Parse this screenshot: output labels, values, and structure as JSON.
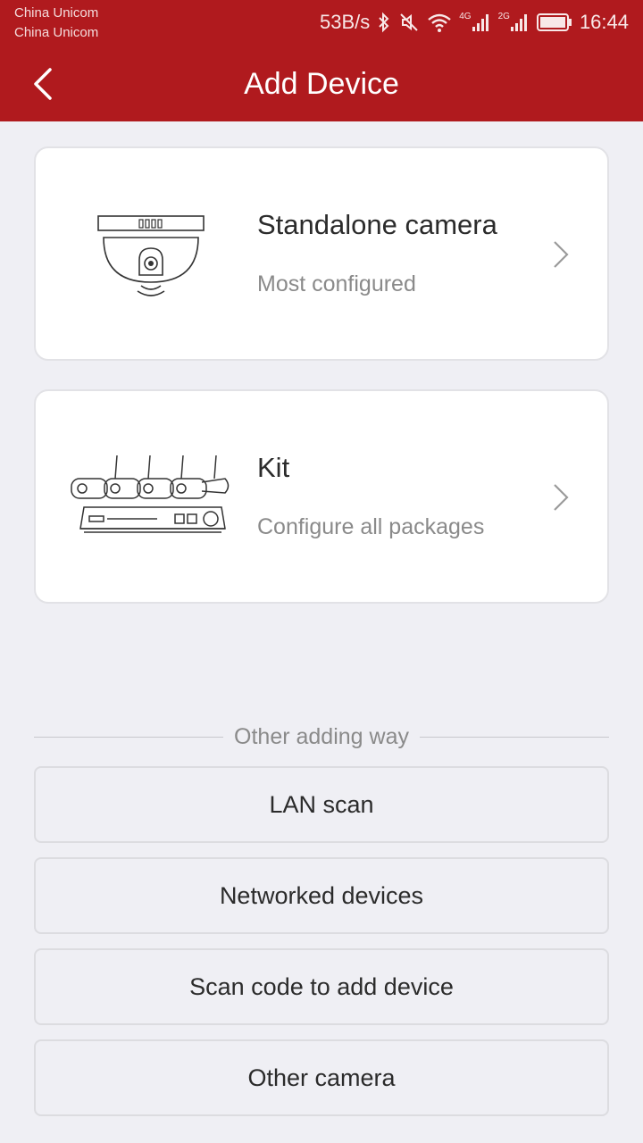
{
  "status_bar": {
    "carrier_1": "China Unicom",
    "carrier_2": "China Unicom",
    "net_speed": "53B/s",
    "network_1": "4G",
    "network_2": "2G",
    "time": "16:44",
    "icons": [
      "bluetooth-icon",
      "mute-icon",
      "wifi-icon",
      "signal-icon",
      "signal-icon",
      "battery-icon"
    ]
  },
  "header": {
    "title": "Add Device",
    "color": "#b01a1e"
  },
  "device_types": [
    {
      "title": "Standalone camera",
      "subtitle": "Most configured",
      "icon": "dome-camera-icon"
    },
    {
      "title": "Kit",
      "subtitle": "Configure all packages",
      "icon": "camera-kit-icon"
    }
  ],
  "other_ways": {
    "heading": "Other adding way",
    "options": [
      "LAN scan",
      "Networked devices",
      "Scan code to add device",
      "Other camera"
    ]
  }
}
